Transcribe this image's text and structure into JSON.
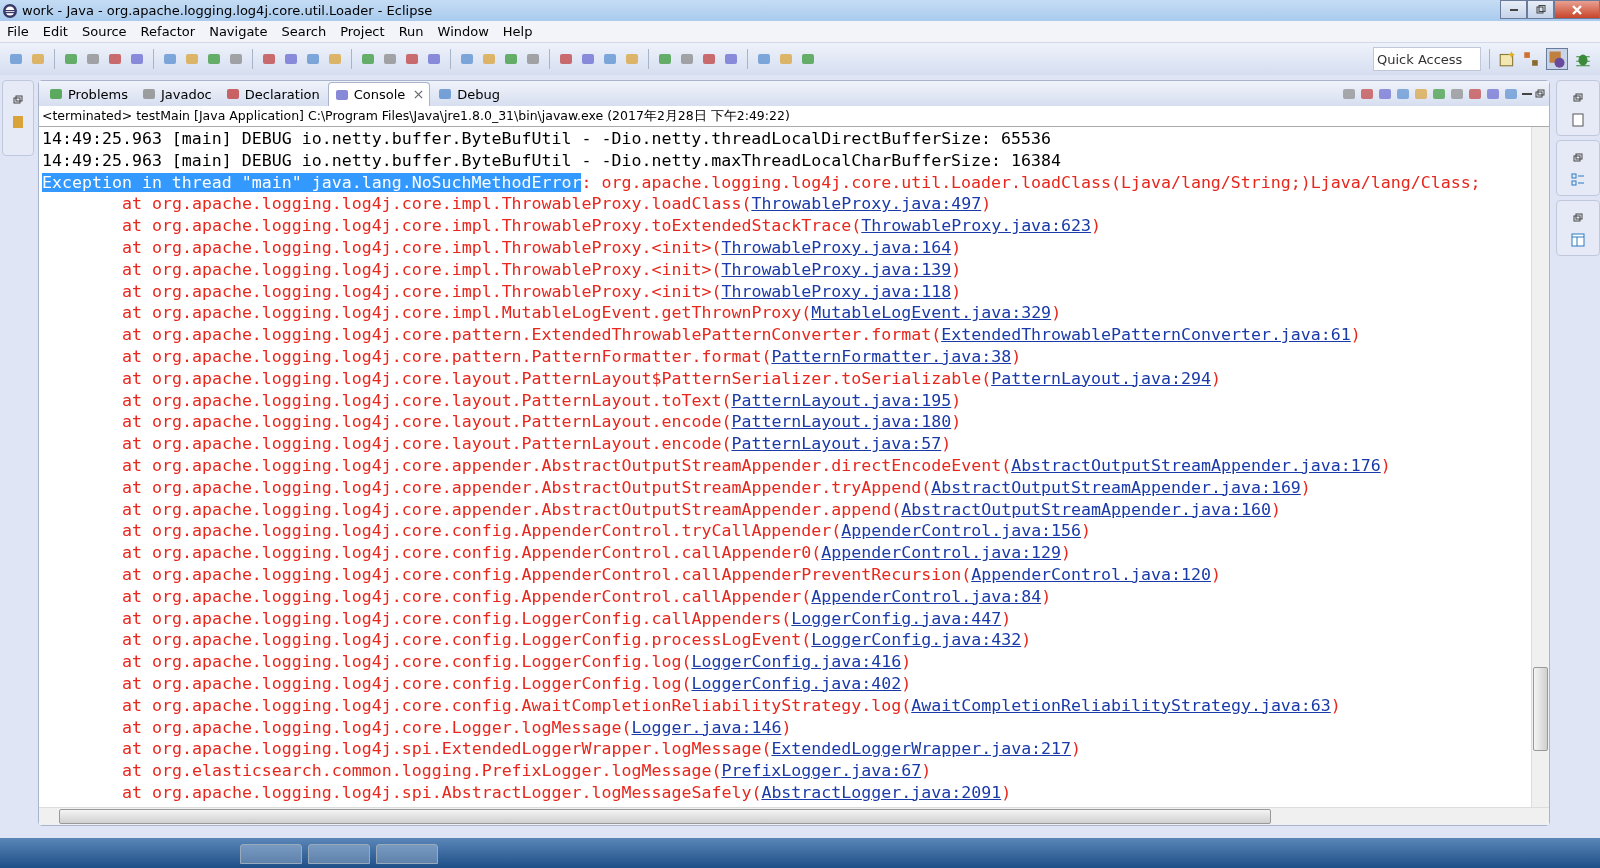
{
  "window": {
    "title": "work - Java - org.apache.logging.log4j.core.util.Loader - Eclipse"
  },
  "menu": [
    "File",
    "Edit",
    "Source",
    "Refactor",
    "Navigate",
    "Search",
    "Project",
    "Run",
    "Window",
    "Help"
  ],
  "quick_access": {
    "placeholder": "Quick Access"
  },
  "tabs": [
    {
      "label": "Problems",
      "selected": false,
      "closable": false
    },
    {
      "label": "Javadoc",
      "selected": false,
      "closable": false
    },
    {
      "label": "Declaration",
      "selected": false,
      "closable": false
    },
    {
      "label": "Console",
      "selected": true,
      "closable": true
    },
    {
      "label": "Debug",
      "selected": false,
      "closable": false
    }
  ],
  "console": {
    "header": "<terminated> testMain [Java Application] C:\\Program Files\\Java\\jre1.8.0_31\\bin\\javaw.exe (2017年2月28日 下午2:49:22)",
    "lines": [
      {
        "kind": "debug",
        "text": "14:49:25.963 [main] DEBUG io.netty.buffer.ByteBufUtil - -Dio.netty.threadLocalDirectBufferSize: 65536"
      },
      {
        "kind": "debug",
        "text": "14:49:25.963 [main] DEBUG io.netty.buffer.ByteBufUtil - -Dio.netty.maxThreadLocalCharBufferSize: 16384"
      },
      {
        "kind": "exception",
        "selected_text": "Exception in thread \"main\" java.lang.NoSuchMethodError",
        "text": ": org.apache.logging.log4j.core.util.Loader.loadClass(Ljava/lang/String;)Ljava/lang/Class;"
      },
      {
        "kind": "frame",
        "text": "at org.apache.logging.log4j.core.impl.ThrowableProxy.loadClass(",
        "link": "ThrowableProxy.java:497",
        "end": ")"
      },
      {
        "kind": "frame",
        "text": "at org.apache.logging.log4j.core.impl.ThrowableProxy.toExtendedStackTrace(",
        "link": "ThrowableProxy.java:623",
        "end": ")"
      },
      {
        "kind": "frame",
        "text": "at org.apache.logging.log4j.core.impl.ThrowableProxy.<init>(",
        "link": "ThrowableProxy.java:164",
        "end": ")"
      },
      {
        "kind": "frame",
        "text": "at org.apache.logging.log4j.core.impl.ThrowableProxy.<init>(",
        "link": "ThrowableProxy.java:139",
        "end": ")"
      },
      {
        "kind": "frame",
        "text": "at org.apache.logging.log4j.core.impl.ThrowableProxy.<init>(",
        "link": "ThrowableProxy.java:118",
        "end": ")"
      },
      {
        "kind": "frame",
        "text": "at org.apache.logging.log4j.core.impl.MutableLogEvent.getThrownProxy(",
        "link": "MutableLogEvent.java:329",
        "end": ")"
      },
      {
        "kind": "frame",
        "text": "at org.apache.logging.log4j.core.pattern.ExtendedThrowablePatternConverter.format(",
        "link": "ExtendedThrowablePatternConverter.java:61",
        "end": ")"
      },
      {
        "kind": "frame",
        "text": "at org.apache.logging.log4j.core.pattern.PatternFormatter.format(",
        "link": "PatternFormatter.java:38",
        "end": ")"
      },
      {
        "kind": "frame",
        "text": "at org.apache.logging.log4j.core.layout.PatternLayout$PatternSerializer.toSerializable(",
        "link": "PatternLayout.java:294",
        "end": ")"
      },
      {
        "kind": "frame",
        "text": "at org.apache.logging.log4j.core.layout.PatternLayout.toText(",
        "link": "PatternLayout.java:195",
        "end": ")"
      },
      {
        "kind": "frame",
        "text": "at org.apache.logging.log4j.core.layout.PatternLayout.encode(",
        "link": "PatternLayout.java:180",
        "end": ")"
      },
      {
        "kind": "frame",
        "text": "at org.apache.logging.log4j.core.layout.PatternLayout.encode(",
        "link": "PatternLayout.java:57",
        "end": ")"
      },
      {
        "kind": "frame",
        "text": "at org.apache.logging.log4j.core.appender.AbstractOutputStreamAppender.directEncodeEvent(",
        "link": "AbstractOutputStreamAppender.java:176",
        "end": ")"
      },
      {
        "kind": "frame",
        "text": "at org.apache.logging.log4j.core.appender.AbstractOutputStreamAppender.tryAppend(",
        "link": "AbstractOutputStreamAppender.java:169",
        "end": ")"
      },
      {
        "kind": "frame",
        "text": "at org.apache.logging.log4j.core.appender.AbstractOutputStreamAppender.append(",
        "link": "AbstractOutputStreamAppender.java:160",
        "end": ")"
      },
      {
        "kind": "frame",
        "text": "at org.apache.logging.log4j.core.config.AppenderControl.tryCallAppender(",
        "link": "AppenderControl.java:156",
        "end": ")"
      },
      {
        "kind": "frame",
        "text": "at org.apache.logging.log4j.core.config.AppenderControl.callAppender0(",
        "link": "AppenderControl.java:129",
        "end": ")"
      },
      {
        "kind": "frame",
        "text": "at org.apache.logging.log4j.core.config.AppenderControl.callAppenderPreventRecursion(",
        "link": "AppenderControl.java:120",
        "end": ")"
      },
      {
        "kind": "frame",
        "text": "at org.apache.logging.log4j.core.config.AppenderControl.callAppender(",
        "link": "AppenderControl.java:84",
        "end": ")"
      },
      {
        "kind": "frame",
        "text": "at org.apache.logging.log4j.core.config.LoggerConfig.callAppenders(",
        "link": "LoggerConfig.java:447",
        "end": ")"
      },
      {
        "kind": "frame",
        "text": "at org.apache.logging.log4j.core.config.LoggerConfig.processLogEvent(",
        "link": "LoggerConfig.java:432",
        "end": ")"
      },
      {
        "kind": "frame",
        "text": "at org.apache.logging.log4j.core.config.LoggerConfig.log(",
        "link": "LoggerConfig.java:416",
        "end": ")"
      },
      {
        "kind": "frame",
        "text": "at org.apache.logging.log4j.core.config.LoggerConfig.log(",
        "link": "LoggerConfig.java:402",
        "end": ")"
      },
      {
        "kind": "frame",
        "text": "at org.apache.logging.log4j.core.config.AwaitCompletionReliabilityStrategy.log(",
        "link": "AwaitCompletionReliabilityStrategy.java:63",
        "end": ")"
      },
      {
        "kind": "frame",
        "text": "at org.apache.logging.log4j.core.Logger.logMessage(",
        "link": "Logger.java:146",
        "end": ")"
      },
      {
        "kind": "frame",
        "text": "at org.apache.logging.log4j.spi.ExtendedLoggerWrapper.logMessage(",
        "link": "ExtendedLoggerWrapper.java:217",
        "end": ")"
      },
      {
        "kind": "frame",
        "text": "at org.elasticsearch.common.logging.PrefixLogger.logMessage(",
        "link": "PrefixLogger.java:67",
        "end": ")"
      },
      {
        "kind": "frame",
        "text": "at org.apache.logging.log4j.spi.AbstractLogger.logMessageSafely(",
        "link": "AbstractLogger.java:2091",
        "end": ")"
      }
    ]
  }
}
